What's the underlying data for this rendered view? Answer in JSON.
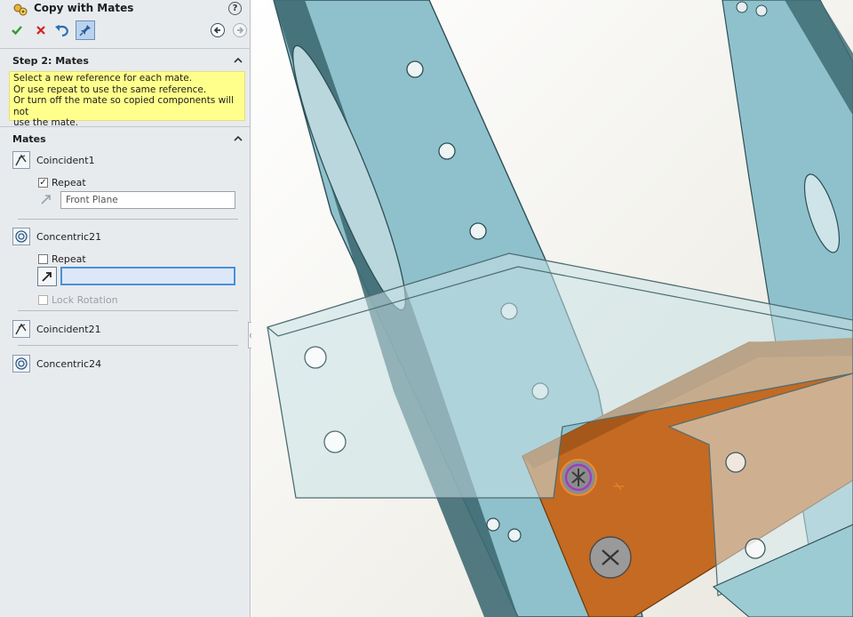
{
  "panel": {
    "title": "Copy with Mates",
    "step_label": "Step 2: Mates",
    "message_lines": [
      "Select a new reference for each mate.",
      "Or use repeat to use the same reference.",
      "Or turn off the mate so copied components will not",
      "use the mate."
    ],
    "mates_section_label": "Mates",
    "mates": [
      {
        "name": "Coincident1",
        "type": "coincident",
        "repeat_label": "Repeat",
        "repeat_checked": true,
        "reference_value": "Front Plane"
      },
      {
        "name": "Concentric21",
        "type": "concentric",
        "repeat_label": "Repeat",
        "repeat_checked": false,
        "reference_value": "",
        "lock_rotation_label": "Lock Rotation"
      },
      {
        "name": "Coincident21",
        "type": "coincident"
      },
      {
        "name": "Concentric24",
        "type": "concentric"
      }
    ],
    "checkmark": "✓"
  },
  "colors": {
    "panel_bg": "#e8ebee",
    "message_bg": "#ffff8c",
    "frame_blue": "#8fc1cc",
    "frame_dark": "#3f6c73",
    "bracket_orange": "#c46a22",
    "active_field_border": "#4a90d9"
  }
}
